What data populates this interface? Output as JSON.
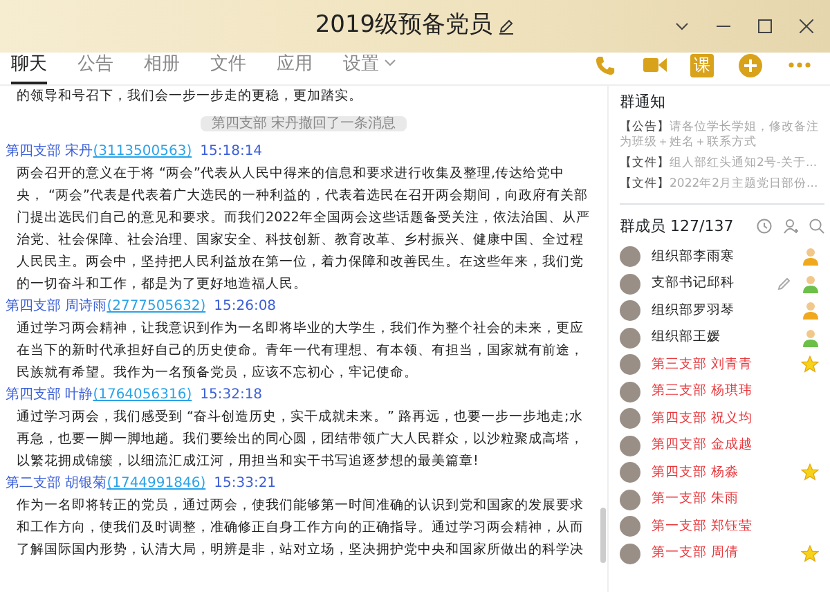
{
  "window": {
    "title": "2019级预备党员"
  },
  "tabs": [
    {
      "label": "聊天",
      "selected": true,
      "dropdown": false
    },
    {
      "label": "公告",
      "selected": false,
      "dropdown": false
    },
    {
      "label": "相册",
      "selected": false,
      "dropdown": false
    },
    {
      "label": "文件",
      "selected": false,
      "dropdown": false
    },
    {
      "label": "应用",
      "selected": false,
      "dropdown": false
    },
    {
      "label": "设置",
      "selected": false,
      "dropdown": true
    }
  ],
  "toolbar": {
    "lesson_button": "课"
  },
  "chat": {
    "top_line": "的领导和号召下，我们会一步一步走的更稳，更加踏实。",
    "system_notice": "第四支部 宋丹撤回了一条消息",
    "messages": [
      {
        "sender": "第四支部 宋丹",
        "qq": "(3113500563)",
        "time": "15:18:14",
        "text": "两会召开的意义在于将 “两会”代表从人民中得来的信息和要求进行收集及整理,传达给党中央， “两会”代表是代表着广大选民的一种利益的，代表着选民在召开两会期间，向政府有关部门提出选民们自己的意见和要求。而我们2022年全国两会这些话题备受关注，依法治国、从严治党、社会保障、社会治理、国家安全、科技创新、教育改革、乡村振兴、健康中国、全过程人民民主。两会中，坚持把人民利益放在第一位，着力保障和改善民生。在这些年来，我们党的一切奋斗和工作，都是为了更好地造福人民。"
      },
      {
        "sender": "第四支部 周诗雨",
        "qq": "(2777505632)",
        "time": "15:26:08",
        "text": "通过学习两会精神，让我意识到作为一名即将毕业的大学生，我们作为整个社会的未来，更应在当下的新时代承担好自己的历史使命。青年一代有理想、有本领、有担当，国家就有前途，民族就有希望。我作为一名预备党员，应该不忘初心，牢记使命。"
      },
      {
        "sender": "第四支部 叶静",
        "qq": "(1764056316)",
        "time": "15:32:18",
        "text": "通过学习两会，我们感受到 “奋斗创造历史，实干成就未来。” 路再远，也要一步一步地走;水再急，也要一脚一脚地趟。我们要绘出的同心圆，团结带领广大人民群众，以沙粒聚成高塔，以繁花拥成锦簇，以细流汇成江河，用担当和实干书写追逐梦想的最美篇章!"
      },
      {
        "sender": "第二支部 胡银菊",
        "qq": "(1744991846)",
        "time": "15:33:21",
        "text": "作为一名即将转正的党员，通过两会，使我们能够第一时间准确的认识到党和国家的发展要求和工作方向，使我们及时调整，准确修正自身工作方向的正确指导。通过学习两会精神，从而了解国际国内形势，认清大局，明辨是非，站对立场，坚决拥护党中央和国家所做出的科学决"
      }
    ]
  },
  "group_notice": {
    "title": "群通知",
    "items": [
      {
        "tag": "【公告】",
        "text": "请各位学长学姐，修改备注为班级＋姓名＋联系方式"
      },
      {
        "tag": "【文件】",
        "text": "组人部红头通知2号-关于..."
      },
      {
        "tag": "【文件】",
        "text": "2022年2月主题党日部份..."
      }
    ]
  },
  "members": {
    "title": "群成员 127/137",
    "list": [
      {
        "name": "组织部李雨寒",
        "color": "#222222",
        "kind": "admin",
        "editable": false
      },
      {
        "name": "支部书记邱科",
        "color": "#222222",
        "kind": "member",
        "editable": true
      },
      {
        "name": "组织部罗羽琴",
        "color": "#222222",
        "kind": "admin",
        "editable": false
      },
      {
        "name": "组织部王媛",
        "color": "#222222",
        "kind": "member",
        "editable": false
      },
      {
        "name": "第三支部 刘青青",
        "color": "#e8383d",
        "kind": "star",
        "editable": false
      },
      {
        "name": "第三支部 杨琪玮",
        "color": "#e8383d",
        "kind": "plain",
        "editable": false
      },
      {
        "name": "第四支部  祝义均",
        "color": "#e8383d",
        "kind": "plain",
        "editable": false
      },
      {
        "name": "第四支部 金成越",
        "color": "#e8383d",
        "kind": "plain",
        "editable": false
      },
      {
        "name": "第四支部 杨淼",
        "color": "#e8383d",
        "kind": "star",
        "editable": false
      },
      {
        "name": "第一支部  朱雨",
        "color": "#e8383d",
        "kind": "plain",
        "editable": false
      },
      {
        "name": "第一支部 郑钰莹",
        "color": "#e8383d",
        "kind": "plain",
        "editable": false
      },
      {
        "name": "第一支部 周倩",
        "color": "#e8383d",
        "kind": "star",
        "editable": false
      }
    ]
  }
}
